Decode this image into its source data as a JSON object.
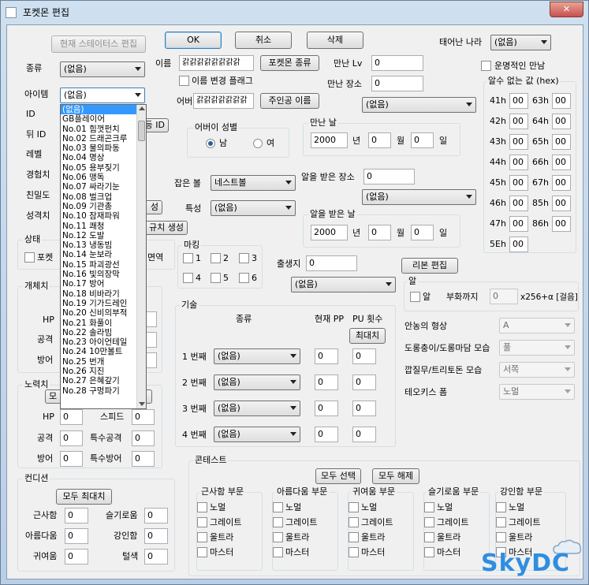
{
  "window": {
    "title": "포켓몬 편집",
    "close_glyph": "✕"
  },
  "top_buttons": {
    "stat_edit": "현재 스테이터스 편집",
    "ok": "OK",
    "cancel": "취소",
    "delete": "삭제"
  },
  "left": {
    "species_label": "종류",
    "species_value": "(없음)",
    "item_label": "아이템",
    "item_value": "(없음)",
    "id_label": "ID",
    "sid_label": "뒤 ID",
    "sid_btn_part": "등 ID",
    "level_label": "레벨",
    "exp_label": "경험치",
    "friend_label": "친밀도",
    "nature_label": "성격치",
    "gen_btn_part": "성",
    "new_gen_btn_part": "규치 생성"
  },
  "item_list": [
    "(없음)",
    "GB플레이어",
    "No.01 힘껏펀치",
    "No.02 드래곤크루",
    "No.03 물의파동",
    "No.04 명상",
    "No.05 용부짖기",
    "No.06 맹독",
    "No.07 싸라기눈",
    "No.08 벌크업",
    "No.09 기관총",
    "No.10 잠재파워",
    "No.11 쾌청",
    "No.12 도발",
    "No.13 냉동빔",
    "No.14 눈보라",
    "No.15 파괴광선",
    "No.16 빛의장막",
    "No.17 방어",
    "No.18 비바라기",
    "No.19 기가드레인",
    "No.20 신비의부적",
    "No.21 화풀이",
    "No.22 솔라빔",
    "No.23 아이언테일",
    "No.24 10만볼트",
    "No.25 번개",
    "No.26 지진",
    "No.27 은혜갚기",
    "No.28 구멍파기"
  ],
  "state": {
    "title": "상태",
    "pokerus_part": "포켓",
    "area_part": "면역"
  },
  "iv": {
    "title": "개체치",
    "hp": "HP",
    "atk": "공격",
    "def": "방어"
  },
  "ev": {
    "title": "노력치",
    "all_btn_part": "모",
    "hp": "HP",
    "hp_value": "0",
    "speed_part": "스피드",
    "speed_value": "0",
    "atk": "공격",
    "atk_value": "0",
    "spatk": "특수공격",
    "spatk_value": "0",
    "def": "방어",
    "def_value": "0",
    "spdef": "특수방어",
    "spdef_value": "0"
  },
  "condition": {
    "title": "컨디션",
    "max_all": "모두 최대치",
    "cool": "근사함",
    "cool_value": "0",
    "beauty": "아름다움",
    "beauty_value": "0",
    "cute": "귀여움",
    "cute_value": "0",
    "clever": "슬기로움",
    "clever_value": "0",
    "tough": "강인함",
    "tough_value": "0",
    "sheen": "털색",
    "sheen_value": "0"
  },
  "name": {
    "label": "이름",
    "value": "갉갉갉갉갉갉갉갉",
    "species_name_btn": "포켓몬 종류",
    "flag_label": "이름 변경 플래그"
  },
  "ot": {
    "label": "어버이",
    "value": "갉갉갉갉갉갉갉",
    "hero_name_btn": "주인공 이름",
    "gender_title": "어버이 성별",
    "male": "남",
    "female": "여"
  },
  "met": {
    "level_label": "만난 Lv",
    "level_value": "0",
    "place_label": "만난 장소",
    "place_value": "0",
    "place_dd": "(없음)",
    "date_title": "만난 날",
    "year": "2000",
    "year_unit": "년",
    "month": "0",
    "month_unit": "월",
    "day": "0",
    "day_unit": "일"
  },
  "ball": {
    "label": "잡은 볼",
    "value": "네스트볼"
  },
  "ability": {
    "label": "특성",
    "value": "(없음)"
  },
  "egg_place": {
    "label": "알을 받은 장소",
    "value": "0",
    "dd": "(없음)"
  },
  "egg_date": {
    "title": "알을 받은 날",
    "year": "2000",
    "year_unit": "년",
    "month": "0",
    "month_unit": "월",
    "day": "0",
    "day_unit": "일"
  },
  "marking": {
    "title": "마킹",
    "items": [
      "1",
      "2",
      "3",
      "4",
      "5",
      "6"
    ]
  },
  "birthplace": {
    "label": "출생지",
    "value": "0",
    "dd": "(없음)"
  },
  "ribbon_btn": "리본 편집",
  "egg": {
    "title": "알",
    "check_label": "알",
    "hatch_label": "부화까지",
    "hatch_value": "0",
    "formula": "x256+α [걸음]"
  },
  "origin": {
    "label": "태어난 나라",
    "value": "(없음)"
  },
  "fateful": {
    "label": "운명적인 만남"
  },
  "unknown": {
    "title": "알수 없는 값 (hex)",
    "left": [
      {
        "k": "41h",
        "v": "00"
      },
      {
        "k": "42h",
        "v": "00"
      },
      {
        "k": "43h",
        "v": "00"
      },
      {
        "k": "44h",
        "v": "00"
      },
      {
        "k": "45h",
        "v": "00"
      },
      {
        "k": "46h",
        "v": "00"
      },
      {
        "k": "47h",
        "v": "00"
      },
      {
        "k": "5Eh",
        "v": "00"
      }
    ],
    "right": [
      {
        "k": "63h",
        "v": "00"
      },
      {
        "k": "64h",
        "v": "00"
      },
      {
        "k": "65h",
        "v": "00"
      },
      {
        "k": "66h",
        "v": "00"
      },
      {
        "k": "67h",
        "v": "00"
      },
      {
        "k": "85h",
        "v": "00"
      },
      {
        "k": "86h",
        "v": "00"
      }
    ]
  },
  "moves": {
    "title": "기술",
    "col_kind": "종류",
    "col_pp": "현재 PP",
    "col_pu": "PU 횟수",
    "max_btn": "최대치",
    "rows": [
      {
        "label": "1 번째",
        "move": "(없음)",
        "pp": "0",
        "pu": "0"
      },
      {
        "label": "2 번째",
        "move": "(없음)",
        "pp": "0",
        "pu": "0"
      },
      {
        "label": "3 번째",
        "move": "(없음)",
        "pp": "0",
        "pu": "0"
      },
      {
        "label": "4 번째",
        "move": "(없음)",
        "pp": "0",
        "pu": "0"
      }
    ]
  },
  "forms": [
    {
      "label": "안농의 형상",
      "value": "A"
    },
    {
      "label": "도롱충이/도롱마담 모습",
      "value": "풀"
    },
    {
      "label": "깝질무/트리토돈 모습",
      "value": "서쪽"
    },
    {
      "label": "테오키스 폼",
      "value": "노멀"
    }
  ],
  "contest": {
    "title": "콘테스트",
    "select_all": "모두 선택",
    "clear_all": "모두 해제",
    "groups": [
      {
        "title": "근사함 부문",
        "items": [
          "노멀",
          "그레이트",
          "울트라",
          "마스터"
        ]
      },
      {
        "title": "아름다움 부문",
        "items": [
          "노멀",
          "그레이트",
          "울트라",
          "마스터"
        ]
      },
      {
        "title": "귀여움 부문",
        "items": [
          "노멀",
          "그레이트",
          "울트라",
          "마스터"
        ]
      },
      {
        "title": "슬기로움 부문",
        "items": [
          "노멀",
          "그레이트",
          "울트라",
          "마스터"
        ]
      },
      {
        "title": "강인함 부문",
        "items": [
          "노멀",
          "그레이트",
          "울트라",
          "마스터"
        ]
      }
    ]
  },
  "watermark": "SkyDC"
}
